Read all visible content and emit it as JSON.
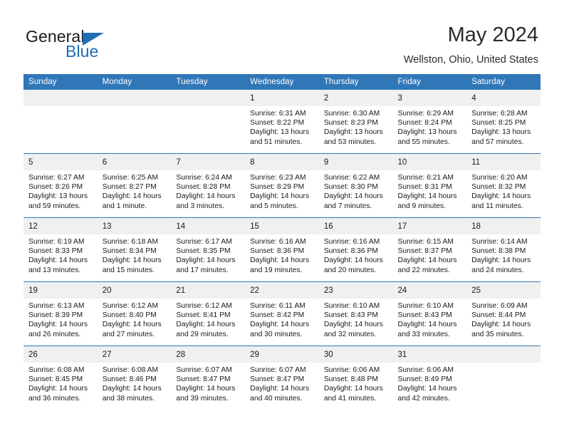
{
  "brand": {
    "word_one": "General",
    "word_two": "Blue",
    "logo_icon": "triangle-logo-icon"
  },
  "header": {
    "month_title": "May 2024",
    "location": "Wellston, Ohio, United States"
  },
  "colors": {
    "header_blue": "#3077b8",
    "brand_blue": "#1f6db5",
    "daynum_bg": "#f0f0f0"
  },
  "calendar": {
    "weekday_headers": [
      "Sunday",
      "Monday",
      "Tuesday",
      "Wednesday",
      "Thursday",
      "Friday",
      "Saturday"
    ],
    "weeks": [
      [
        {
          "day": "",
          "empty": true,
          "sunrise": "",
          "sunset": "",
          "daylight_line1": "",
          "daylight_line2": ""
        },
        {
          "day": "",
          "empty": true,
          "sunrise": "",
          "sunset": "",
          "daylight_line1": "",
          "daylight_line2": ""
        },
        {
          "day": "",
          "empty": true,
          "sunrise": "",
          "sunset": "",
          "daylight_line1": "",
          "daylight_line2": ""
        },
        {
          "day": "1",
          "empty": false,
          "sunrise": "Sunrise: 6:31 AM",
          "sunset": "Sunset: 8:22 PM",
          "daylight_line1": "Daylight: 13 hours",
          "daylight_line2": "and 51 minutes."
        },
        {
          "day": "2",
          "empty": false,
          "sunrise": "Sunrise: 6:30 AM",
          "sunset": "Sunset: 8:23 PM",
          "daylight_line1": "Daylight: 13 hours",
          "daylight_line2": "and 53 minutes."
        },
        {
          "day": "3",
          "empty": false,
          "sunrise": "Sunrise: 6:29 AM",
          "sunset": "Sunset: 8:24 PM",
          "daylight_line1": "Daylight: 13 hours",
          "daylight_line2": "and 55 minutes."
        },
        {
          "day": "4",
          "empty": false,
          "sunrise": "Sunrise: 6:28 AM",
          "sunset": "Sunset: 8:25 PM",
          "daylight_line1": "Daylight: 13 hours",
          "daylight_line2": "and 57 minutes."
        }
      ],
      [
        {
          "day": "5",
          "empty": false,
          "sunrise": "Sunrise: 6:27 AM",
          "sunset": "Sunset: 8:26 PM",
          "daylight_line1": "Daylight: 13 hours",
          "daylight_line2": "and 59 minutes."
        },
        {
          "day": "6",
          "empty": false,
          "sunrise": "Sunrise: 6:25 AM",
          "sunset": "Sunset: 8:27 PM",
          "daylight_line1": "Daylight: 14 hours",
          "daylight_line2": "and 1 minute."
        },
        {
          "day": "7",
          "empty": false,
          "sunrise": "Sunrise: 6:24 AM",
          "sunset": "Sunset: 8:28 PM",
          "daylight_line1": "Daylight: 14 hours",
          "daylight_line2": "and 3 minutes."
        },
        {
          "day": "8",
          "empty": false,
          "sunrise": "Sunrise: 6:23 AM",
          "sunset": "Sunset: 8:29 PM",
          "daylight_line1": "Daylight: 14 hours",
          "daylight_line2": "and 5 minutes."
        },
        {
          "day": "9",
          "empty": false,
          "sunrise": "Sunrise: 6:22 AM",
          "sunset": "Sunset: 8:30 PM",
          "daylight_line1": "Daylight: 14 hours",
          "daylight_line2": "and 7 minutes."
        },
        {
          "day": "10",
          "empty": false,
          "sunrise": "Sunrise: 6:21 AM",
          "sunset": "Sunset: 8:31 PM",
          "daylight_line1": "Daylight: 14 hours",
          "daylight_line2": "and 9 minutes."
        },
        {
          "day": "11",
          "empty": false,
          "sunrise": "Sunrise: 6:20 AM",
          "sunset": "Sunset: 8:32 PM",
          "daylight_line1": "Daylight: 14 hours",
          "daylight_line2": "and 11 minutes."
        }
      ],
      [
        {
          "day": "12",
          "empty": false,
          "sunrise": "Sunrise: 6:19 AM",
          "sunset": "Sunset: 8:33 PM",
          "daylight_line1": "Daylight: 14 hours",
          "daylight_line2": "and 13 minutes."
        },
        {
          "day": "13",
          "empty": false,
          "sunrise": "Sunrise: 6:18 AM",
          "sunset": "Sunset: 8:34 PM",
          "daylight_line1": "Daylight: 14 hours",
          "daylight_line2": "and 15 minutes."
        },
        {
          "day": "14",
          "empty": false,
          "sunrise": "Sunrise: 6:17 AM",
          "sunset": "Sunset: 8:35 PM",
          "daylight_line1": "Daylight: 14 hours",
          "daylight_line2": "and 17 minutes."
        },
        {
          "day": "15",
          "empty": false,
          "sunrise": "Sunrise: 6:16 AM",
          "sunset": "Sunset: 8:36 PM",
          "daylight_line1": "Daylight: 14 hours",
          "daylight_line2": "and 19 minutes."
        },
        {
          "day": "16",
          "empty": false,
          "sunrise": "Sunrise: 6:16 AM",
          "sunset": "Sunset: 8:36 PM",
          "daylight_line1": "Daylight: 14 hours",
          "daylight_line2": "and 20 minutes."
        },
        {
          "day": "17",
          "empty": false,
          "sunrise": "Sunrise: 6:15 AM",
          "sunset": "Sunset: 8:37 PM",
          "daylight_line1": "Daylight: 14 hours",
          "daylight_line2": "and 22 minutes."
        },
        {
          "day": "18",
          "empty": false,
          "sunrise": "Sunrise: 6:14 AM",
          "sunset": "Sunset: 8:38 PM",
          "daylight_line1": "Daylight: 14 hours",
          "daylight_line2": "and 24 minutes."
        }
      ],
      [
        {
          "day": "19",
          "empty": false,
          "sunrise": "Sunrise: 6:13 AM",
          "sunset": "Sunset: 8:39 PM",
          "daylight_line1": "Daylight: 14 hours",
          "daylight_line2": "and 26 minutes."
        },
        {
          "day": "20",
          "empty": false,
          "sunrise": "Sunrise: 6:12 AM",
          "sunset": "Sunset: 8:40 PM",
          "daylight_line1": "Daylight: 14 hours",
          "daylight_line2": "and 27 minutes."
        },
        {
          "day": "21",
          "empty": false,
          "sunrise": "Sunrise: 6:12 AM",
          "sunset": "Sunset: 8:41 PM",
          "daylight_line1": "Daylight: 14 hours",
          "daylight_line2": "and 29 minutes."
        },
        {
          "day": "22",
          "empty": false,
          "sunrise": "Sunrise: 6:11 AM",
          "sunset": "Sunset: 8:42 PM",
          "daylight_line1": "Daylight: 14 hours",
          "daylight_line2": "and 30 minutes."
        },
        {
          "day": "23",
          "empty": false,
          "sunrise": "Sunrise: 6:10 AM",
          "sunset": "Sunset: 8:43 PM",
          "daylight_line1": "Daylight: 14 hours",
          "daylight_line2": "and 32 minutes."
        },
        {
          "day": "24",
          "empty": false,
          "sunrise": "Sunrise: 6:10 AM",
          "sunset": "Sunset: 8:43 PM",
          "daylight_line1": "Daylight: 14 hours",
          "daylight_line2": "and 33 minutes."
        },
        {
          "day": "25",
          "empty": false,
          "sunrise": "Sunrise: 6:09 AM",
          "sunset": "Sunset: 8:44 PM",
          "daylight_line1": "Daylight: 14 hours",
          "daylight_line2": "and 35 minutes."
        }
      ],
      [
        {
          "day": "26",
          "empty": false,
          "sunrise": "Sunrise: 6:08 AM",
          "sunset": "Sunset: 8:45 PM",
          "daylight_line1": "Daylight: 14 hours",
          "daylight_line2": "and 36 minutes."
        },
        {
          "day": "27",
          "empty": false,
          "sunrise": "Sunrise: 6:08 AM",
          "sunset": "Sunset: 8:46 PM",
          "daylight_line1": "Daylight: 14 hours",
          "daylight_line2": "and 38 minutes."
        },
        {
          "day": "28",
          "empty": false,
          "sunrise": "Sunrise: 6:07 AM",
          "sunset": "Sunset: 8:47 PM",
          "daylight_line1": "Daylight: 14 hours",
          "daylight_line2": "and 39 minutes."
        },
        {
          "day": "29",
          "empty": false,
          "sunrise": "Sunrise: 6:07 AM",
          "sunset": "Sunset: 8:47 PM",
          "daylight_line1": "Daylight: 14 hours",
          "daylight_line2": "and 40 minutes."
        },
        {
          "day": "30",
          "empty": false,
          "sunrise": "Sunrise: 6:06 AM",
          "sunset": "Sunset: 8:48 PM",
          "daylight_line1": "Daylight: 14 hours",
          "daylight_line2": "and 41 minutes."
        },
        {
          "day": "31",
          "empty": false,
          "sunrise": "Sunrise: 6:06 AM",
          "sunset": "Sunset: 8:49 PM",
          "daylight_line1": "Daylight: 14 hours",
          "daylight_line2": "and 42 minutes."
        },
        {
          "day": "",
          "empty": true,
          "sunrise": "",
          "sunset": "",
          "daylight_line1": "",
          "daylight_line2": ""
        }
      ]
    ]
  }
}
